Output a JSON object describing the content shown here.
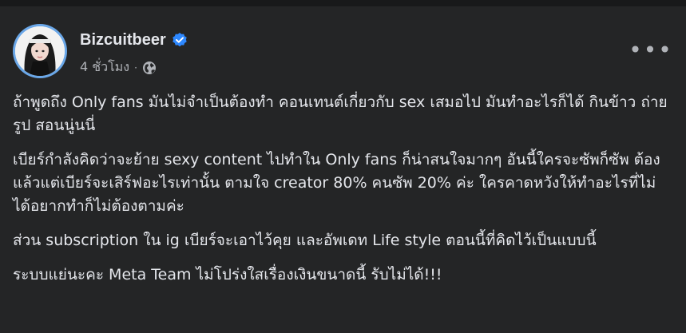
{
  "post": {
    "author": "Bizcuitbeer",
    "time": "4 ชั่วโมง",
    "separator": "·",
    "icons": {
      "verified": "verified-badge-icon",
      "audience": "globe-icon",
      "menu": "more-options-icon"
    },
    "colors": {
      "background": "#242526",
      "text": "#e4e6eb",
      "secondary": "#b0b3b8",
      "verified": "#2d88ff"
    },
    "paragraphs": [
      "ถ้าพูดถึง Only fans มันไม่จำเป็นต้องทำ คอนเทนต์เกี่ยวกับ sex เสมอไป มันทำอะไรก็ได้ กินข้าว ถ่ายรูป สอนนู่นนี่",
      "เบียร์กำลังคิดว่าจะย้าย sexy content ไปทำใน Only fans ก็น่าสนใจมากๆ อันนี้ใครจะซัพก็ซัพ ต้องแล้วแต่เบียร์จะเสิร์ฟอะไรเท่านั้น ตามใจ creator 80% คนซัพ 20% ค่ะ ใครคาดหวังให้ทำอะไรที่ไม่ได้อยากทำก็ไม่ต้องตามค่ะ",
      "ส่วน subscription ใน ig เบียร์จะเอาไว้คุย และอัพเดท Life style ตอนนี้ที่คิดไว้เป็นแบบนี้",
      "ระบบแย่นะคะ Meta Team ไม่โปร่งใสเรื่องเงินขนาดนี้ รับไม่ได้!!!"
    ]
  }
}
